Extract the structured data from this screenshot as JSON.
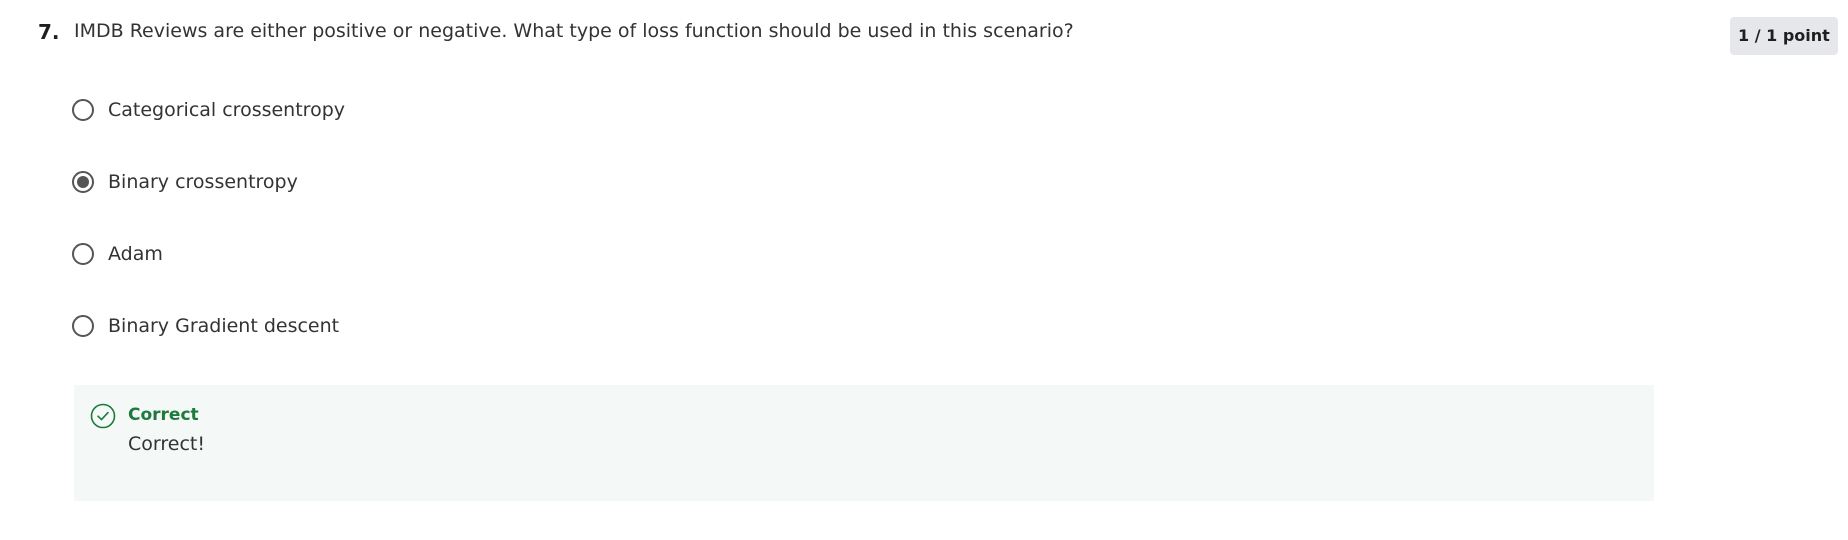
{
  "question": {
    "number": "7.",
    "text": "IMDB Reviews are either positive or negative. What type of loss function should be used in this scenario?",
    "points": "1 / 1 point"
  },
  "options": [
    {
      "label": "Categorical crossentropy",
      "selected": false
    },
    {
      "label": "Binary crossentropy",
      "selected": true
    },
    {
      "label": "Adam",
      "selected": false
    },
    {
      "label": "Binary Gradient descent",
      "selected": false
    }
  ],
  "feedback": {
    "icon": "check-circle-icon",
    "title": "Correct",
    "message": "Correct!",
    "color": "#1e7a3c",
    "background": "#f4f8f7"
  }
}
